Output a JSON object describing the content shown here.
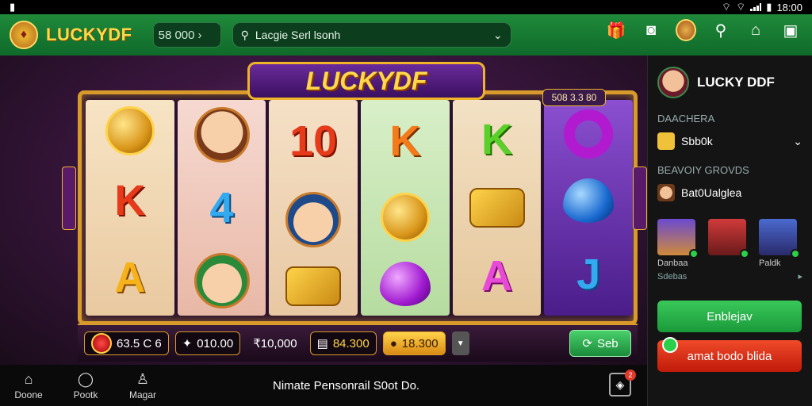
{
  "status_bar": {
    "time": "18:00",
    "left_icon": "sim-icon"
  },
  "topbar": {
    "brand": "LUCKYDF",
    "balance": "58 000",
    "search_text": "Lacgie Serl lsonh",
    "icons": [
      "gift-icon",
      "camera-icon",
      "avatar",
      "search-icon",
      "home-icon",
      "wallet-icon"
    ]
  },
  "game": {
    "logo": "LUCKYDF",
    "jackpot": "508 3.3 80",
    "reels": [
      [
        {
          "t": "coin"
        },
        {
          "t": "K",
          "c": "red"
        },
        {
          "t": "A",
          "c": "gold"
        }
      ],
      [
        {
          "t": "face"
        },
        {
          "t": "4",
          "c": "blue"
        },
        {
          "t": "face-green"
        }
      ],
      [
        {
          "t": "10",
          "c": "red"
        },
        {
          "t": "face-blue"
        },
        {
          "t": "scroll"
        }
      ],
      [
        {
          "t": "K",
          "c": "orange"
        },
        {
          "t": "coin"
        },
        {
          "t": "gem-purple"
        }
      ],
      [
        {
          "t": "K",
          "c": "green"
        },
        {
          "t": "scroll"
        },
        {
          "t": "A",
          "c": "pink"
        }
      ],
      [
        {
          "t": "ring"
        },
        {
          "t": "gem-blue"
        },
        {
          "t": "J",
          "c": "blue"
        }
      ]
    ]
  },
  "betbar": {
    "bet_label": "63.5 C 6",
    "win": "010.00",
    "balance": "₹10,000",
    "coins": "84.300",
    "total": "18.300",
    "spin_label": "Seb"
  },
  "bottomnav": {
    "items": [
      {
        "label": "Doone",
        "icon": "home-icon"
      },
      {
        "label": "Pootk",
        "icon": "chat-icon"
      },
      {
        "label": "Magar",
        "icon": "user-icon"
      }
    ],
    "title": "Nimate Pensonrail S0ot Do.",
    "bag_badge": "2"
  },
  "panel": {
    "name": "LUCKY DDF",
    "section1_label": "DAACHERA",
    "section1_value": "Sbb0k",
    "section2_label": "BEAVOIY GROVDS",
    "section2_value": "Bat0Ualglea",
    "players": [
      {
        "name": "Danbaa"
      },
      {
        "name": ""
      },
      {
        "name": "Paldk"
      }
    ],
    "more_label": "Sdebas",
    "green_btn": "Enblejav",
    "red_btn": "amat bodo blida"
  },
  "colors": {
    "topbar_green": "#1f8a3a",
    "gold": "#f0b429",
    "spin_green": "#3ac85a",
    "red_button": "#f04a2a"
  }
}
